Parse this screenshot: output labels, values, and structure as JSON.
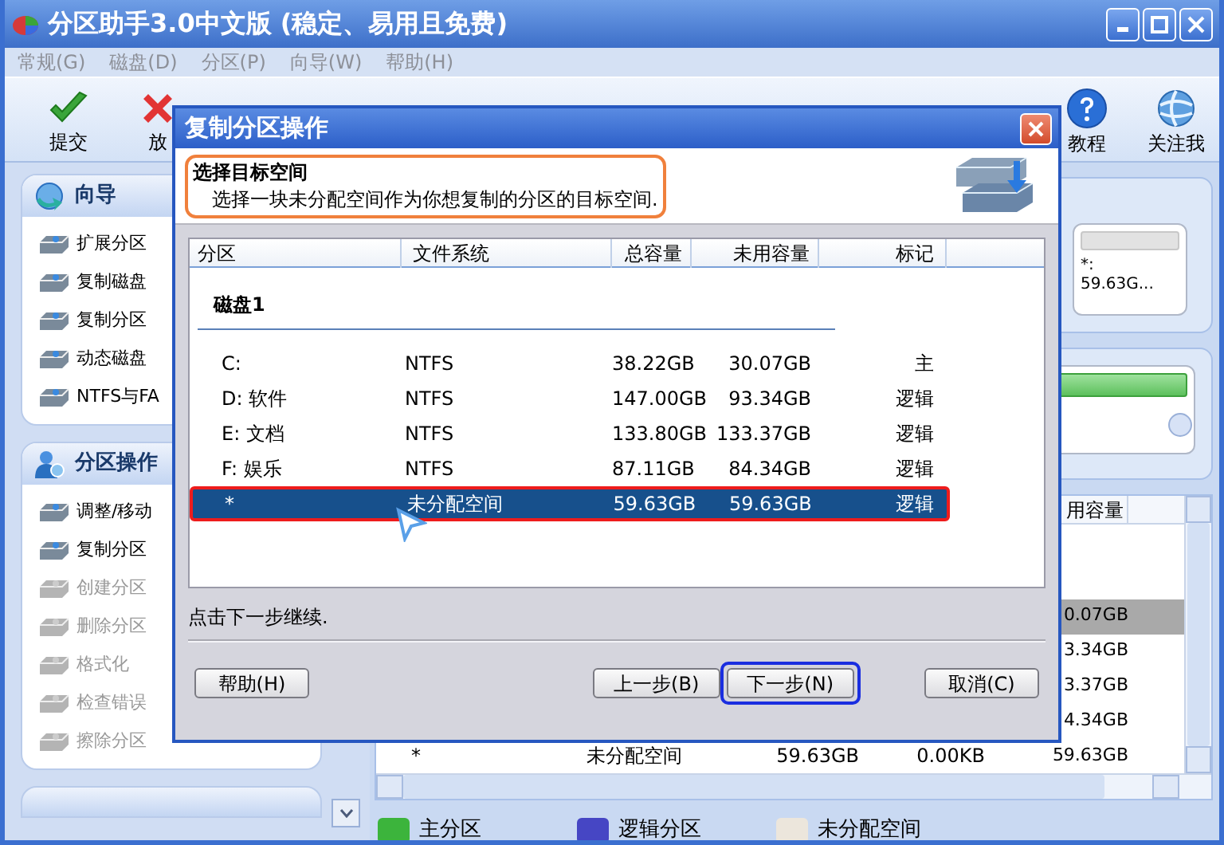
{
  "window": {
    "title": "分区助手3.0中文版 (稳定、易用且免费)"
  },
  "menu": [
    "常规(G)",
    "磁盘(D)",
    "分区(P)",
    "向导(W)",
    "帮助(H)"
  ],
  "toolbar": {
    "left": [
      {
        "label": "提交",
        "kind": "check"
      },
      {
        "label": "放",
        "kind": "cross"
      }
    ],
    "right": [
      {
        "label": "教程",
        "kind": "help"
      },
      {
        "label": "关注我",
        "kind": "globe"
      }
    ]
  },
  "sidebar": {
    "panels": [
      {
        "title": "向导",
        "kind": "wizard",
        "items": [
          {
            "label": "扩展分区",
            "disabled": false
          },
          {
            "label": "复制磁盘",
            "disabled": false
          },
          {
            "label": "复制分区",
            "disabled": false
          },
          {
            "label": "动态磁盘",
            "disabled": false
          },
          {
            "label": "NTFS与FA",
            "disabled": false
          }
        ]
      },
      {
        "title": "分区操作",
        "kind": "operations",
        "items": [
          {
            "label": "调整/移动",
            "disabled": false
          },
          {
            "label": "复制分区",
            "disabled": false
          },
          {
            "label": "创建分区",
            "disabled": true
          },
          {
            "label": "删除分区",
            "disabled": true
          },
          {
            "label": "格式化",
            "disabled": true
          },
          {
            "label": "检查错误",
            "disabled": true
          },
          {
            "label": "擦除分区",
            "disabled": true
          }
        ]
      }
    ]
  },
  "disk_map": {
    "name": "*:",
    "size": "59.63G..."
  },
  "partition_table": {
    "column_5": "用容量",
    "rows": [
      {
        "unused": "0.07GB",
        "selected": true
      },
      {
        "unused": "3.34GB",
        "selected": false
      },
      {
        "unused": "3.37GB",
        "selected": false
      },
      {
        "unused": "4.34GB",
        "selected": false
      },
      {
        "partition": "*",
        "file_system": "未分配空间",
        "total": "59.63GB",
        "used": "0.00KB",
        "unused": "59.63GB",
        "selected": false
      }
    ]
  },
  "legend": [
    {
      "label": "主分区",
      "color": "#3cb43c"
    },
    {
      "label": "逻辑分区",
      "color": "#4646c4"
    },
    {
      "label": "未分配空间",
      "color": "#ece6dc"
    }
  ],
  "dialog": {
    "title": "复制分区操作",
    "heading": "选择目标空间",
    "description": "选择一块未分配空间作为你想复制的分区的目标空间.",
    "columns": [
      "分区",
      "文件系统",
      "总容量",
      "未用容量",
      "标记"
    ],
    "disk": "磁盘1",
    "rows": [
      {
        "partition": "C:",
        "file_system": "NTFS",
        "total": "38.22GB",
        "unused": "30.07GB",
        "flag": "主",
        "selected": false
      },
      {
        "partition": "D: 软件",
        "file_system": "NTFS",
        "total": "147.00GB",
        "unused": "93.34GB",
        "flag": "逻辑",
        "selected": false
      },
      {
        "partition": "E: 文档",
        "file_system": "NTFS",
        "total": "133.80GB",
        "unused": "133.37GB",
        "flag": "逻辑",
        "selected": false
      },
      {
        "partition": "F: 娱乐",
        "file_system": "NTFS",
        "total": "87.11GB",
        "unused": "84.34GB",
        "flag": "逻辑",
        "selected": false
      },
      {
        "partition": "*",
        "file_system": "未分配空间",
        "total": "59.63GB",
        "unused": "59.63GB",
        "flag": "逻辑",
        "selected": true
      }
    ],
    "hint": "点击下一步继续.",
    "buttons": [
      {
        "label": "帮助(H)",
        "kind": "help",
        "focused": false
      },
      {
        "label": "上一步(B)",
        "kind": "back",
        "focused": false
      },
      {
        "label": "下一步(N)",
        "kind": "next",
        "focused": true
      },
      {
        "label": "取消(C)",
        "kind": "cancel",
        "focused": false
      }
    ]
  }
}
